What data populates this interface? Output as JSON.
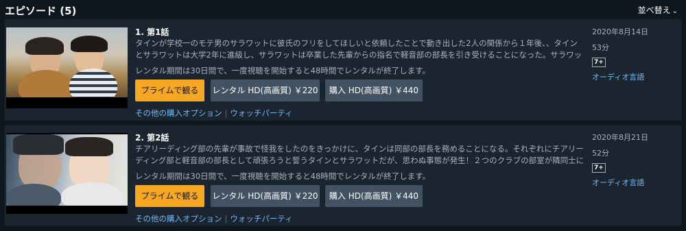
{
  "header": {
    "title": "エピソード (5)",
    "sort_label": "並べ替え",
    "sort_icon": "chevron-down-icon"
  },
  "episodes": [
    {
      "title": "1. 第1話",
      "synopsis": "タインが学校一のモテ男のサラワットに彼氏のフリをしてほしいと依頼したことで動き出した2人の関係から１年後、、タインとサラワットは大学2年に進級し、サラワットは卒業した先輩からの指名で軽音部の部長を引き受けることになった。サラワットはタ…",
      "rental_note": "レンタル期間は30日間で、一度視聴を開始すると48時間でレンタルが終了します。",
      "prime_button": "プライムで観る",
      "rent_button": "レンタル HD(高画質) ￥220",
      "buy_button": "購入 HD(高画質) ￥440",
      "other_options": "その他の購入オプション",
      "watch_party": "ウォッチパーティ",
      "date": "2020年8月14日",
      "duration": "53分",
      "rating": "7+",
      "audio": "オーディオ言語"
    },
    {
      "title": "2. 第2話",
      "synopsis": "チアリーディング部の先輩が事故で怪我をしたのをきっかけに、タインは同部の部長を務めることになる。それぞれにチアリーディング部と軽音部の部長として頑張ろうと誓うタインとサラワットだが、思わぬ事態が発生！２つのクラブの部室が隣同士にな…",
      "rental_note": "レンタル期間は30日間で、一度視聴を開始すると48時間でレンタルが終了します。",
      "prime_button": "プライムで観る",
      "rent_button": "レンタル HD(高画質) ￥220",
      "buy_button": "購入 HD(高画質) ￥440",
      "other_options": "その他の購入オプション",
      "watch_party": "ウォッチパーティ",
      "date": "2020年8月21日",
      "duration": "52分",
      "rating": "7+",
      "audio": "オーディオ言語"
    }
  ],
  "colors": {
    "background": "#0f171e",
    "card": "#1b2530",
    "prime_button": "#f5a623",
    "secondary_button": "#425263",
    "link": "#79b8f3"
  }
}
